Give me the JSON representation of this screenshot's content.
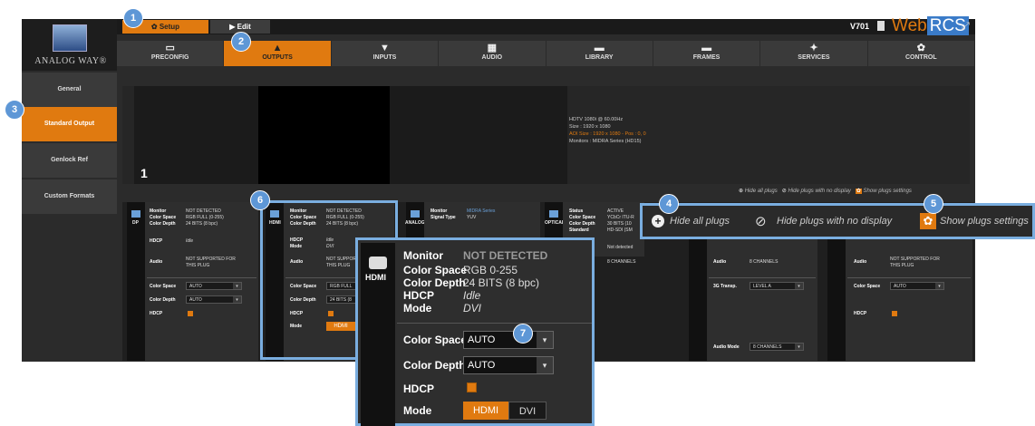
{
  "brand": {
    "logo_text": "ANALOG WAY®",
    "version": "V701",
    "product_web": "Web",
    "product_rcs": "RCS"
  },
  "mode_tabs": [
    {
      "label": "Setup"
    },
    {
      "label": "Edit"
    }
  ],
  "nav": [
    {
      "label": "PRECONFIG"
    },
    {
      "label": "OUTPUTS"
    },
    {
      "label": "INPUTS"
    },
    {
      "label": "AUDIO"
    },
    {
      "label": "LIBRARY"
    },
    {
      "label": "FRAMES"
    },
    {
      "label": "SERVICES"
    },
    {
      "label": "CONTROL"
    }
  ],
  "sidebar": [
    {
      "label": "General"
    },
    {
      "label": "Standard Output"
    },
    {
      "label": "Genlock Ref"
    },
    {
      "label": "Custom Formats"
    }
  ],
  "preview": {
    "screen_number": "1",
    "info": [
      "HDTV 1080i @ 60.00Hz",
      "Size : 1920 x 1080",
      "AOI Size : 1920 x 1080 - Pos : 0, 0",
      "Monitors : MIDRA Series (HD15)"
    ]
  },
  "plug_toggles": {
    "hide_all": "Hide all plugs",
    "hide_no_display": "Hide plugs with no display",
    "show_settings": "Show plugs settings"
  },
  "plugs": {
    "dp": {
      "type": "DP",
      "monitor_k": "Monitor",
      "monitor_v": "NOT DETECTED",
      "cspace_k": "Color Space",
      "cspace_v": "RGB FULL (0-255)",
      "cdepth_k": "Color Depth",
      "cdepth_v": "24 BITS (8 bpc)",
      "hdcp_k": "HDCP",
      "hdcp_v": "Idle",
      "audio_k": "Audio",
      "audio_v1": "NOT SUPPORTED FOR",
      "audio_v2": "THIS PLUG",
      "sel_cspace_k": "Color Space",
      "sel_cspace_v": "AUTO",
      "sel_cdepth_k": "Color Depth",
      "sel_cdepth_v": "AUTO",
      "sel_hdcp_k": "HDCP"
    },
    "hdmi": {
      "type": "HDMI",
      "monitor_k": "Monitor",
      "monitor_v": "NOT DETECTED",
      "cspace_k": "Color Space",
      "cspace_v": "RGB FULL (0-255)",
      "cdepth_k": "Color Depth",
      "cdepth_v": "24 BITS (8 bpc)",
      "hdcp_k": "HDCP",
      "hdcp_v": "Idle",
      "mode_k": "Mode",
      "mode_v": "DVI",
      "audio_k": "Audio",
      "audio_v1": "NOT SUPPORTED",
      "audio_v2": "THIS PLUG",
      "sel_cspace_k": "Color Space",
      "sel_cspace_v": "RGB FULL",
      "sel_cdepth_k": "Color Depth",
      "sel_cdepth_v": "24 BITS (8",
      "sel_hdcp_k": "HDCP",
      "sel_mode_k": "Mode",
      "sel_mode_v": "HDMI"
    },
    "analog": {
      "type": "ANALOG",
      "monitor_k": "Monitor",
      "monitor_v": "MIDRA Series",
      "signal_k": "Signal Type",
      "signal_v": "YUV"
    },
    "optical": {
      "type": "OPTICAL",
      "status_k": "Status",
      "status_v": "ACTIVE",
      "cspace_k": "Color Space",
      "cspace_v": "YCbCr ITU-R",
      "cdepth_k": "Color Depth",
      "cdepth_v": "30 BITS (10",
      "standard_k": "Standard",
      "standard_v": "HD-SDI (SM",
      "notdet": "Not detected",
      "channels": "8 CHANNELS"
    },
    "sdi": {
      "audio_k": "Audio",
      "audio_v": "8 CHANNELS",
      "transp_k": "3G Transp.",
      "transp_v": "LEVEL A",
      "amode_k": "Audio Mode",
      "amode_v": "8 CHANNELS"
    },
    "last": {
      "audio_k": "Audio",
      "audio_v1": "NOT SUPPORTED FOR",
      "audio_v2": "THIS PLUG",
      "cspace_k": "Color Space",
      "cspace_v": "AUTO",
      "hdcp_k": "HDCP"
    }
  },
  "zoom": {
    "type": "HDMI",
    "monitor_k": "Monitor",
    "monitor_v": "NOT DETECTED",
    "cspace_k": "Color Space",
    "cspace_v": "RGB 0-255",
    "cdepth_k": "Color Depth",
    "cdepth_v": "24 BITS (8 bpc)",
    "hdcp_k": "HDCP",
    "hdcp_v": "Idle",
    "mode_k": "Mode",
    "mode_v": "DVI",
    "sel_cspace_k": "Color Space",
    "sel_cspace_v": "AUTO",
    "sel_cdepth_k": "Color Depth",
    "sel_cdepth_v": "AUTO",
    "sel_hdcp_k": "HDCP",
    "sel_mode_k": "Mode",
    "btn_hdmi": "HDMI",
    "btn_dvi": "DVI"
  },
  "callouts": [
    "1",
    "2",
    "3",
    "4",
    "5",
    "6",
    "7"
  ],
  "colors": {
    "accent": "#e07a10",
    "callout": "#5e97d6",
    "highlight": "#7aaee0"
  }
}
